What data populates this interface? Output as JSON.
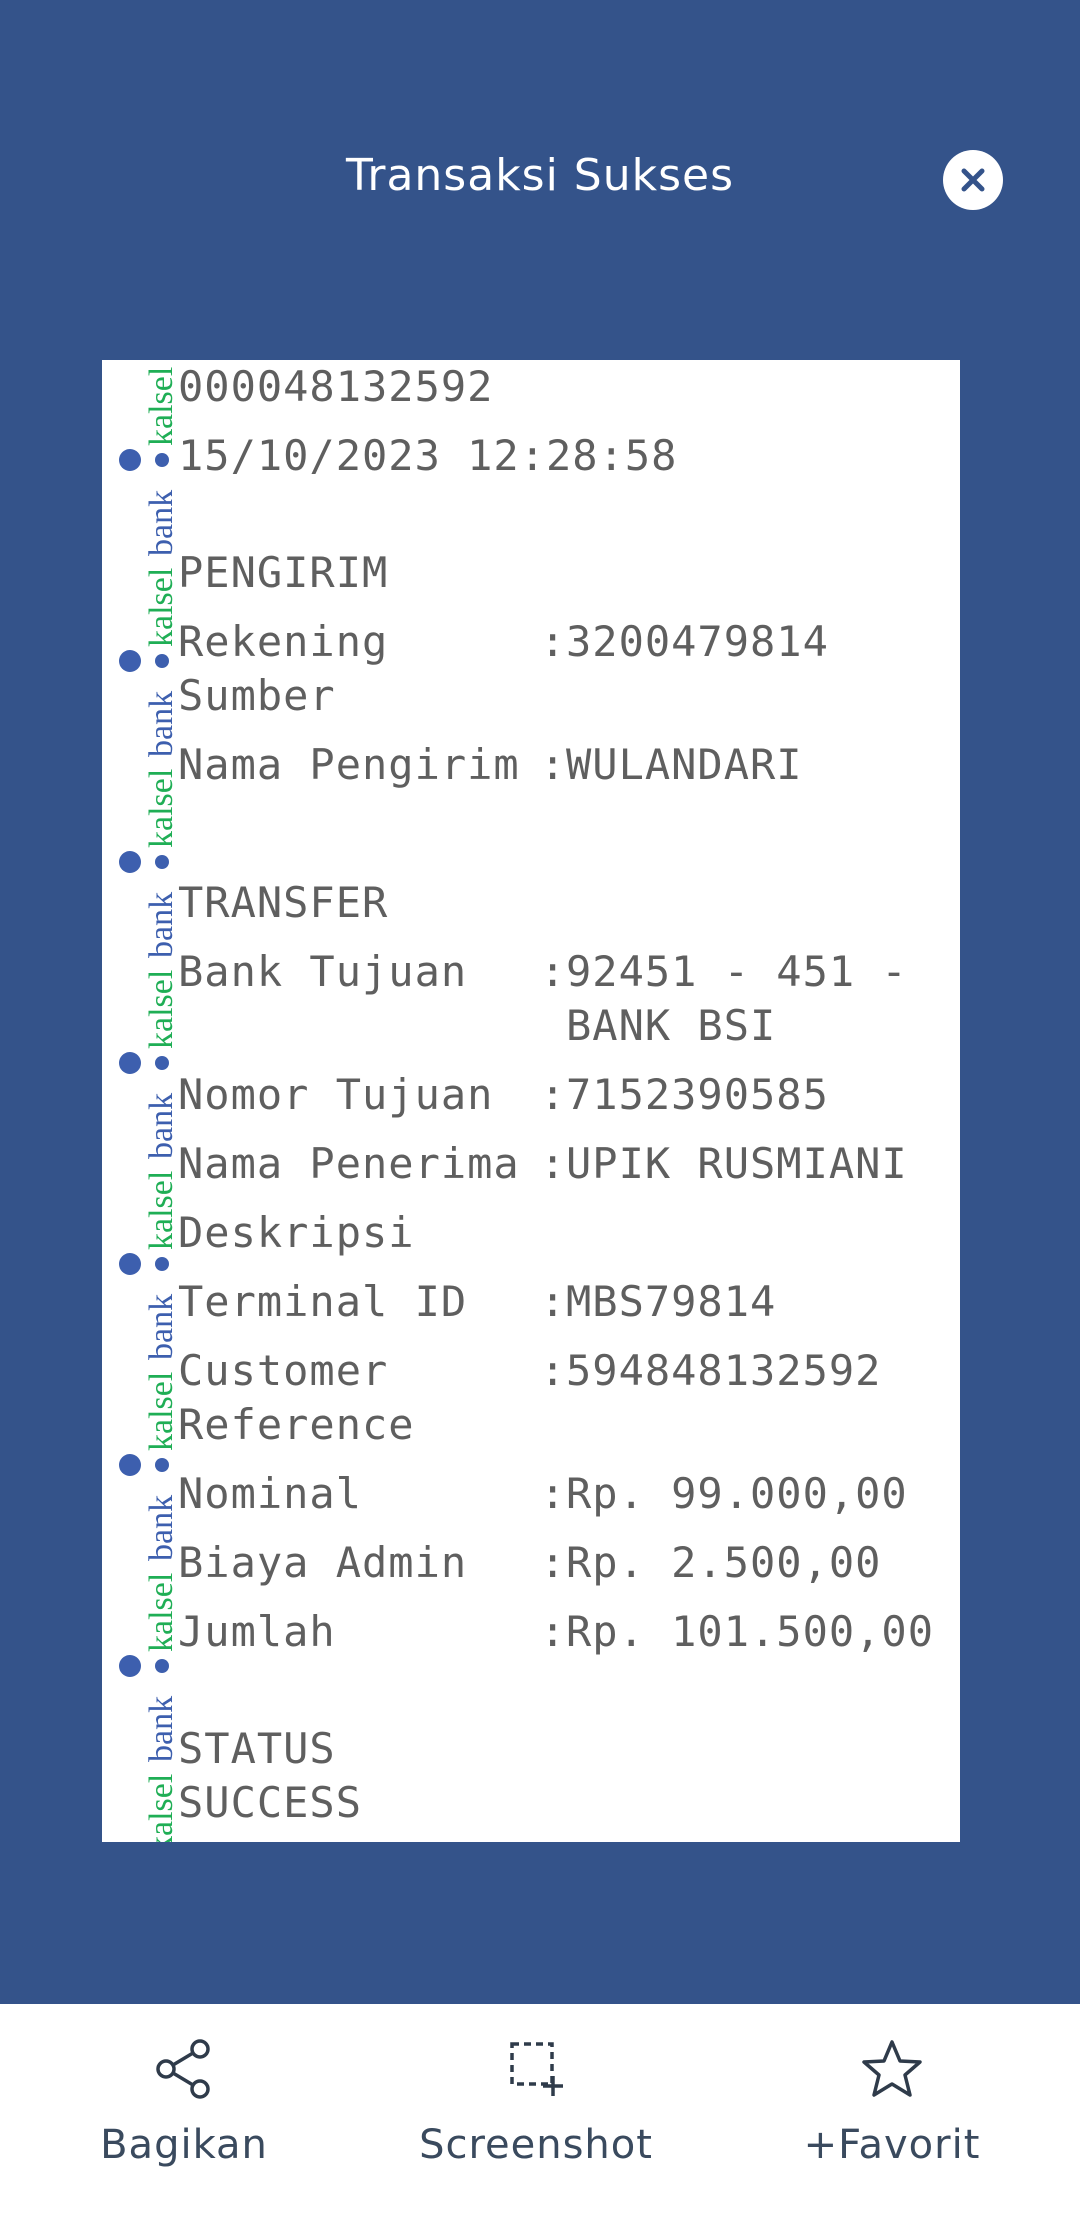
{
  "header": {
    "title": "Transaksi Sukses",
    "close_icon": "close-icon"
  },
  "colors": {
    "background": "#34538a",
    "watermark_green": "#1fae55",
    "watermark_blue": "#3d5fae"
  },
  "watermark": {
    "brand_a": "kalsel",
    "brand_b": "bank"
  },
  "receipt": {
    "ref_number": "000048132592",
    "datetime": "15/10/2023 12:28:58",
    "sender_heading": "PENGIRIM",
    "rekening_label_1": "Rekening",
    "rekening_label_2": "Sumber",
    "rekening_value": "3200479814",
    "nama_pengirim_label": "Nama Pengirim",
    "nama_pengirim_value": "WULANDARI",
    "transfer_heading": "TRANSFER",
    "bank_tujuan_label": "Bank Tujuan",
    "bank_tujuan_value_1": "92451 - 451 -",
    "bank_tujuan_value_2": "BANK BSI",
    "nomor_tujuan_label": "Nomor Tujuan",
    "nomor_tujuan_value": "7152390585",
    "nama_penerima_label": "Nama Penerima",
    "nama_penerima_value": "UPIK RUSMIANI",
    "deskripsi_label": "Deskripsi",
    "terminal_label": "Terminal ID",
    "terminal_value": "MBS79814",
    "customer_label_1": "Customer",
    "customer_label_2": "Reference",
    "customer_value": "594848132592",
    "nominal_label": "Nominal",
    "nominal_value": "Rp. 99.000,00",
    "biaya_label": "Biaya Admin",
    "biaya_value": "Rp. 2.500,00",
    "jumlah_label": "Jumlah",
    "jumlah_value": "Rp. 101.500,00",
    "status_heading": "STATUS",
    "status_value": "SUCCESS",
    "colon": ":"
  },
  "actions": [
    {
      "label": "Bagikan",
      "icon": "share-icon"
    },
    {
      "label": "Screenshot",
      "icon": "screenshot-icon"
    },
    {
      "label": "+Favorit",
      "icon": "star-icon"
    }
  ]
}
